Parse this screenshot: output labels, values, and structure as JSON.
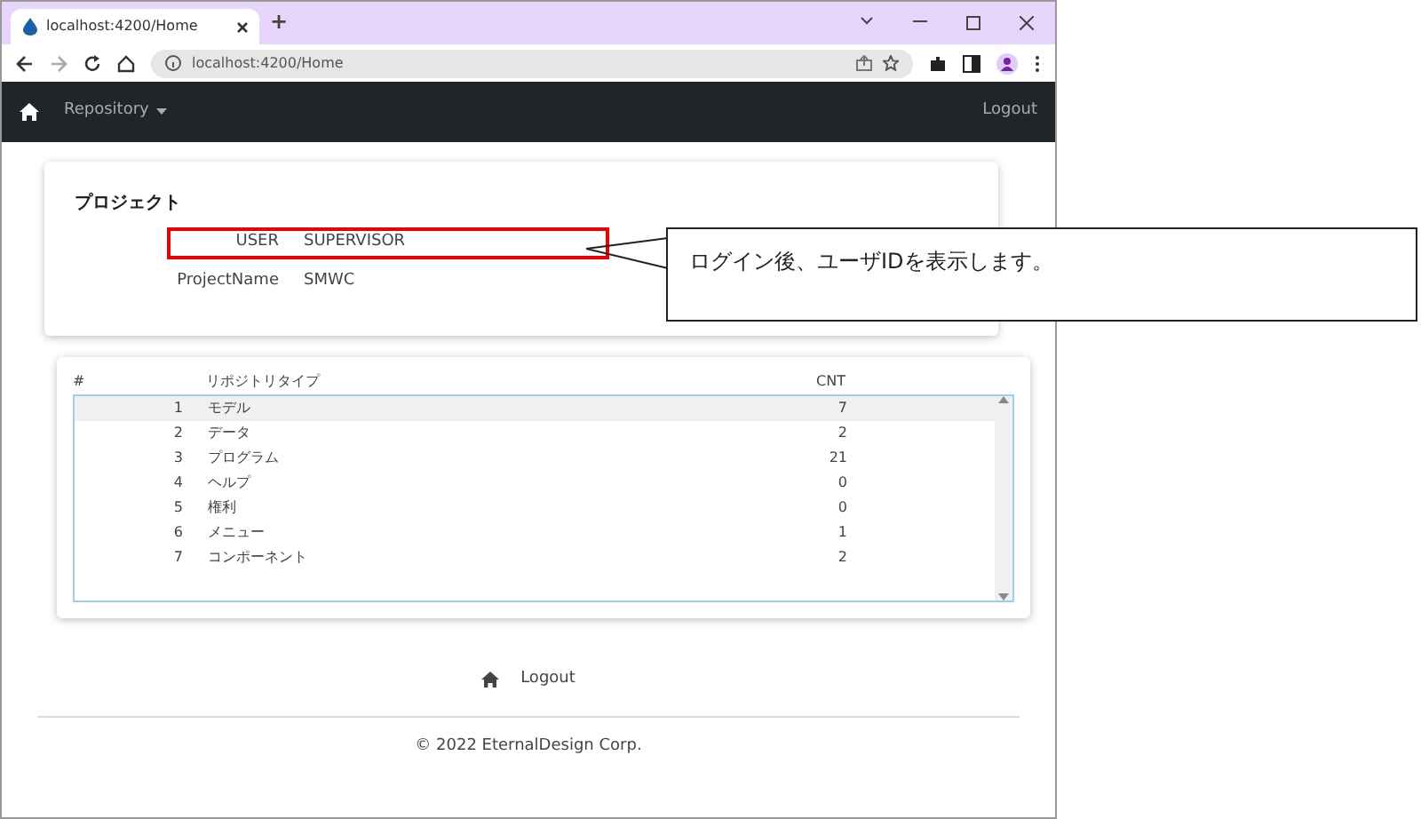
{
  "browser": {
    "tab_title": "localhost:4200/Home",
    "new_tab": "+",
    "url": "localhost:4200/Home"
  },
  "navbar": {
    "menu": "Repository",
    "logout": "Logout"
  },
  "project": {
    "title": "プロジェクト",
    "fields": [
      {
        "label": "USER",
        "value": "SUPERVISOR",
        "highlighted": true
      },
      {
        "label": "ProjectName",
        "value": "SMWC"
      }
    ]
  },
  "callout": {
    "text": "ログイン後、ユーザIDを表示します。"
  },
  "repository_table": {
    "columns": [
      "#",
      "リポジトリタイプ",
      "CNT"
    ],
    "rows": [
      {
        "no": "1",
        "type": "モデル",
        "cnt": "7",
        "selected": true
      },
      {
        "no": "2",
        "type": "データ",
        "cnt": "2",
        "selected": false
      },
      {
        "no": "3",
        "type": "プログラム",
        "cnt": "21",
        "selected": false
      },
      {
        "no": "4",
        "type": "ヘルプ",
        "cnt": "0",
        "selected": false
      },
      {
        "no": "5",
        "type": "権利",
        "cnt": "0",
        "selected": false
      },
      {
        "no": "6",
        "type": "メニュー",
        "cnt": "1",
        "selected": false
      },
      {
        "no": "7",
        "type": "コンポーネント",
        "cnt": "2",
        "selected": false
      }
    ]
  },
  "footer": {
    "logout": "Logout",
    "copyright": "© 2022 EternalDesign Corp."
  }
}
